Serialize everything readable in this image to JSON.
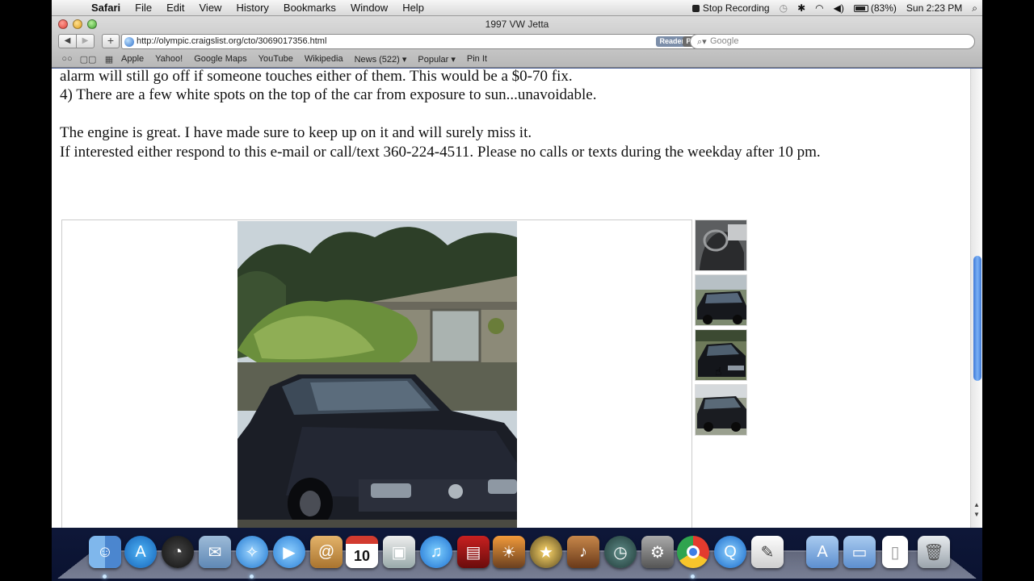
{
  "menubar": {
    "app_name": "Safari",
    "menus": [
      "File",
      "Edit",
      "View",
      "History",
      "Bookmarks",
      "Window",
      "Help"
    ],
    "stop_recording": "Stop Recording",
    "battery": "(83%)",
    "clock": "Sun 2:23 PM"
  },
  "window": {
    "title": "1997 VW Jetta",
    "url": "http://olympic.craigslist.org/cto/3069017356.html",
    "reader_label": "Reader",
    "private_label": "PRIVATE",
    "search_placeholder": "Google"
  },
  "bookmarks": [
    "Apple",
    "Yahoo!",
    "Google Maps",
    "YouTube",
    "Wikipedia",
    "News (522) ▾",
    "Popular ▾",
    "Pin It"
  ],
  "post": {
    "lines": [
      "alarm will still go off if someone touches either of them. This would be a $0-70 fix.",
      "4) There are a few white spots on the top of the car from exposure to sun...unavoidable.",
      "",
      "The engine is great. I have made sure to keep up on it and will surely miss it.",
      "If interested either respond to this e-mail or call/text 360-224-4511. Please no calls or texts during the weekday after 10 pm."
    ]
  },
  "gallery": {
    "thumbnail_count": 4
  },
  "dock": {
    "calendar_day": "10",
    "apps": [
      "Finder",
      "App Store",
      "Dashboard",
      "Mail",
      "Safari",
      "FaceTime",
      "Address Book",
      "iCal",
      "Photo Booth",
      "iTunes",
      "Photo Strip",
      "iPhoto",
      "iMovie",
      "GarageBand",
      "Time Machine",
      "System Preferences",
      "Chrome",
      "QuickTime",
      "TextEdit",
      "Applications",
      "Documents",
      "Document",
      "Trash"
    ]
  },
  "colors": {
    "scroll_thumb": "#3f7ad8",
    "close": "#e0443a",
    "minimize": "#e0a120",
    "zoom": "#3fa32f"
  }
}
